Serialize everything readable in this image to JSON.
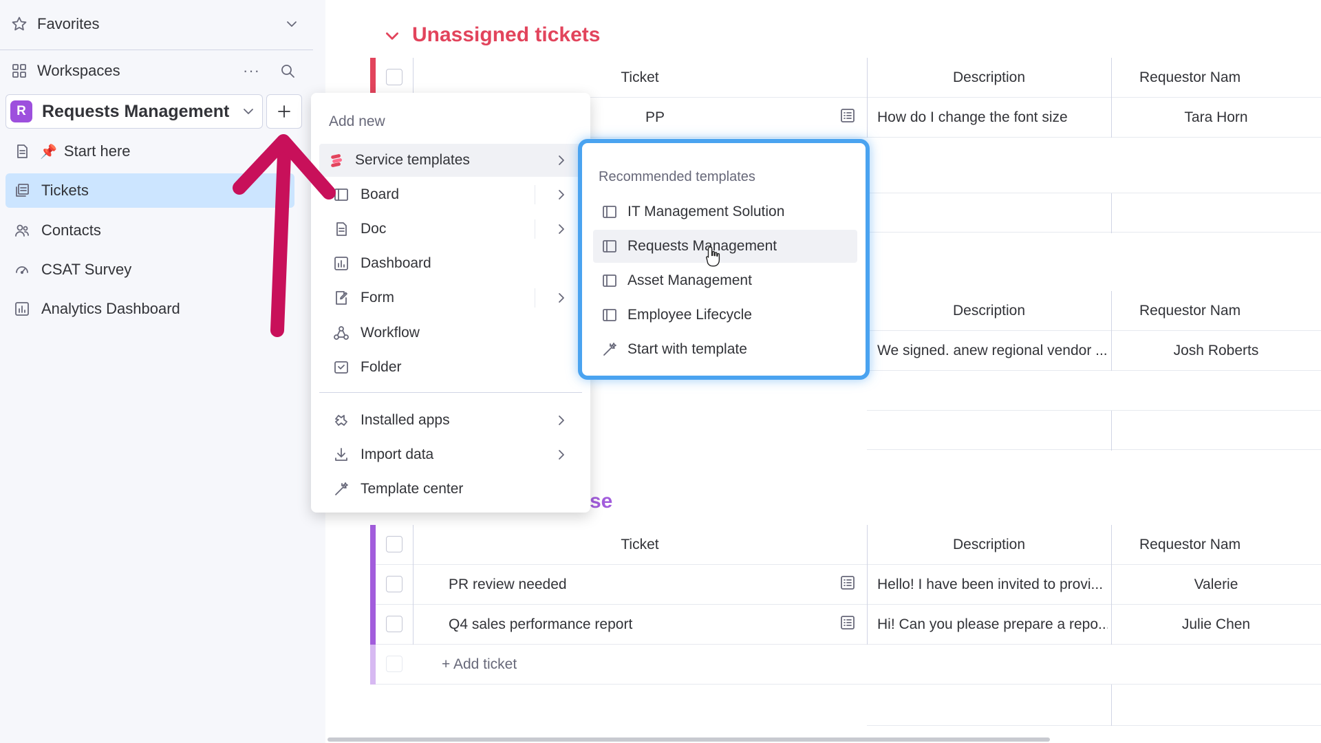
{
  "sidebar": {
    "favorites_label": "Favorites",
    "workspaces_label": "Workspaces",
    "more_label": "···",
    "workspace": {
      "badge": "R",
      "name": "Requests Management"
    },
    "items": [
      {
        "label": "Start here"
      },
      {
        "label": "Tickets"
      },
      {
        "label": "Contacts"
      },
      {
        "label": "CSAT Survey"
      },
      {
        "label": "Analytics Dashboard"
      }
    ]
  },
  "main": {
    "group1": {
      "title": "Unassigned tickets",
      "headers": {
        "ticket": "Ticket",
        "description": "Description",
        "requestor": "Requestor Nam"
      },
      "rows": [
        {
          "ticket": "PP",
          "description": "How do I change the font size",
          "requestor": "Tara Horn"
        }
      ]
    },
    "group2": {
      "headers": {
        "description": "Description",
        "requestor": "Requestor Nam"
      },
      "rows": [
        {
          "description": "We signed. anew regional vendor ...",
          "requestor": "Josh Roberts"
        }
      ]
    },
    "group3": {
      "title_fragment": "se",
      "headers": {
        "ticket": "Ticket",
        "description": "Description",
        "requestor": "Requestor Nam"
      },
      "rows": [
        {
          "ticket": "PR review needed",
          "description": "Hello! I have been invited to provi...",
          "requestor": "Valerie"
        },
        {
          "ticket": "Q4 sales performance report",
          "description": "Hi! Can you please prepare a repo...",
          "requestor": "Julie Chen"
        }
      ],
      "add_label": "+ Add ticket"
    }
  },
  "menu": {
    "header": "Add new",
    "items": [
      {
        "label": "Service templates"
      },
      {
        "label": "Board"
      },
      {
        "label": "Doc"
      },
      {
        "label": "Dashboard"
      },
      {
        "label": "Form"
      },
      {
        "label": "Workflow"
      },
      {
        "label": "Folder"
      },
      {
        "label": "Installed apps"
      },
      {
        "label": "Import data"
      },
      {
        "label": "Template center"
      }
    ]
  },
  "submenu": {
    "header": "Recommended templates",
    "items": [
      {
        "label": "IT Management Solution"
      },
      {
        "label": "Requests Management"
      },
      {
        "label": "Asset Management"
      },
      {
        "label": "Employee Lifecycle"
      },
      {
        "label": "Start with template"
      }
    ]
  },
  "colors": {
    "group1": "#e2445c",
    "group3": "#a25ddc",
    "arrow": "#c8105a",
    "highlight": "#4aa3f0",
    "active_nav": "#cce5ff"
  }
}
